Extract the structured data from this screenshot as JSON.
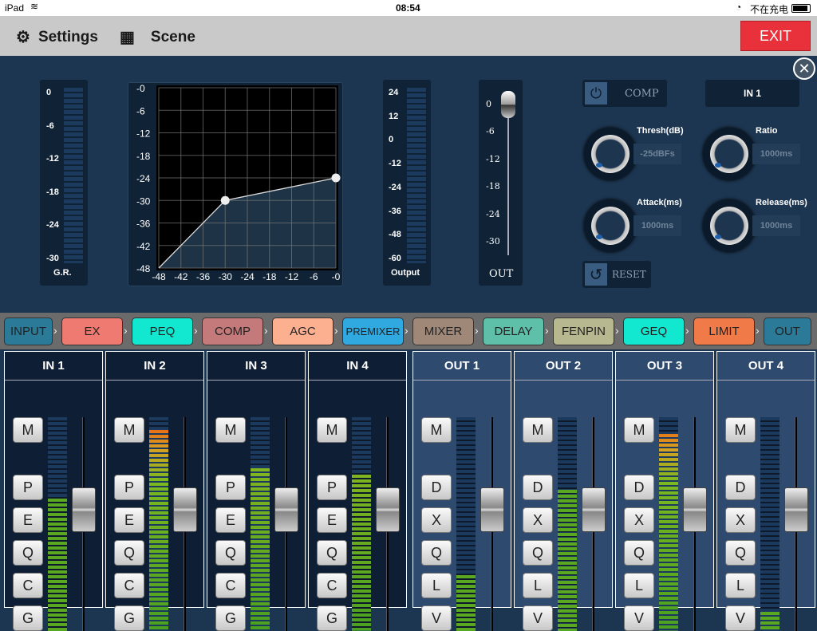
{
  "status_bar": {
    "device": "iPad",
    "time": "08:54",
    "charging": "不在充电"
  },
  "header": {
    "settings_label": "Settings",
    "scene_label": "Scene",
    "exit_label": "EXIT"
  },
  "comp_panel": {
    "gr_meter": {
      "label": "G.R.",
      "ticks": [
        "0",
        "-6",
        "-12",
        "-18",
        "-24",
        "-30"
      ]
    },
    "graph": {
      "type": "line",
      "y_ticks": [
        "-0",
        "-6",
        "-12",
        "-18",
        "-24",
        "-30",
        "-36",
        "-42",
        "-48"
      ],
      "x_ticks": [
        "-48",
        "-42",
        "-36",
        "-30",
        "-24",
        "-18",
        "-12",
        "-6",
        "-0"
      ],
      "xlim": [
        -48,
        0
      ],
      "ylim": [
        -48,
        0
      ],
      "points": [
        [
          -48,
          -48
        ],
        [
          -30,
          -30
        ],
        [
          0,
          -24
        ]
      ]
    },
    "output_meter": {
      "label": "Output",
      "ticks": [
        "24",
        "12",
        "0",
        "-12",
        "-24",
        "-36",
        "-48",
        "-60"
      ]
    },
    "out_fader": {
      "label": "OUT",
      "ticks": [
        "0",
        "-6",
        "-12",
        "-18",
        "-24",
        "-30"
      ],
      "value_db": 0
    },
    "comp_toggle_label": "COMP",
    "channel_select": "IN 1",
    "thresh": {
      "label": "Thresh(dB)",
      "value": "-25dBFs"
    },
    "ratio": {
      "label": "Ratio",
      "value": "1000ms"
    },
    "attack": {
      "label": "Attack(ms)",
      "value": "1000ms"
    },
    "release": {
      "label": "Release(ms)",
      "value": "1000ms"
    },
    "reset_label": "RESET"
  },
  "chain": [
    {
      "label": "INPUT",
      "color": "#2a7a98"
    },
    {
      "label": "EX",
      "color": "#ee7a72"
    },
    {
      "label": "PEQ",
      "color": "#12e8d0"
    },
    {
      "label": "COMP",
      "color": "#c47a7a"
    },
    {
      "label": "AGC",
      "color": "#fdb090"
    },
    {
      "label": "PREMIXER",
      "color": "#30a8e0"
    },
    {
      "label": "MIXER",
      "color": "#a08878"
    },
    {
      "label": "DELAY",
      "color": "#5ec0a8"
    },
    {
      "label": "FENPIN",
      "color": "#b8b890"
    },
    {
      "label": "GEQ",
      "color": "#12e8d0"
    },
    {
      "label": "LIMIT",
      "color": "#f07a48"
    },
    {
      "label": "OUT",
      "color": "#2a7a98"
    }
  ],
  "channels": [
    {
      "name": "IN 1",
      "type": "in",
      "buttons": [
        "M",
        "P",
        "E",
        "Q",
        "C",
        "G"
      ],
      "level": 0.62
    },
    {
      "name": "IN 2",
      "type": "in",
      "buttons": [
        "M",
        "P",
        "E",
        "Q",
        "C",
        "G"
      ],
      "level": 0.94
    },
    {
      "name": "IN 3",
      "type": "in",
      "buttons": [
        "M",
        "P",
        "E",
        "Q",
        "C",
        "G"
      ],
      "level": 0.76
    },
    {
      "name": "IN 4",
      "type": "in",
      "buttons": [
        "M",
        "P",
        "E",
        "Q",
        "C",
        "G"
      ],
      "level": 0.73
    },
    {
      "name": "OUT 1",
      "type": "out",
      "buttons": [
        "M",
        "D",
        "X",
        "Q",
        "L",
        "V"
      ],
      "level": 0.26
    },
    {
      "name": "OUT 2",
      "type": "out",
      "buttons": [
        "M",
        "D",
        "X",
        "Q",
        "L",
        "V"
      ],
      "level": 0.66
    },
    {
      "name": "OUT 3",
      "type": "out",
      "buttons": [
        "M",
        "D",
        "X",
        "Q",
        "L",
        "V"
      ],
      "level": 0.92
    },
    {
      "name": "OUT 4",
      "type": "out",
      "buttons": [
        "M",
        "D",
        "X",
        "Q",
        "L",
        "V"
      ],
      "level": 0.09
    }
  ]
}
